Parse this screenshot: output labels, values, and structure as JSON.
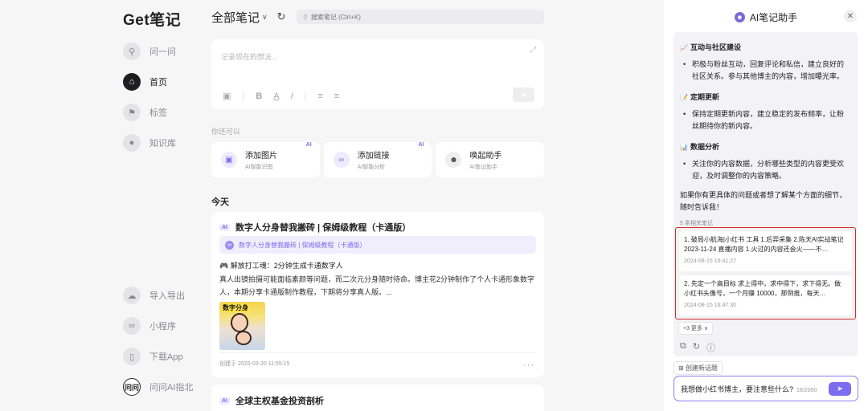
{
  "app": {
    "logo": "Get笔记"
  },
  "sidebar": {
    "top_items": [
      {
        "label": "问一问",
        "icon": "search-icon"
      },
      {
        "label": "首页",
        "icon": "home-icon"
      },
      {
        "label": "标签",
        "icon": "tag-icon"
      },
      {
        "label": "知识库",
        "icon": "knowledge-icon"
      }
    ],
    "bottom_items": [
      {
        "label": "导入导出",
        "icon": "cloud-icon"
      },
      {
        "label": "小程序",
        "icon": "miniapp-icon"
      },
      {
        "label": "下载App",
        "icon": "phone-icon"
      },
      {
        "label": "问问AI指北",
        "icon": "wenwen-icon",
        "icon_text": "问问"
      }
    ]
  },
  "header": {
    "title": "全部笔记",
    "search_placeholder": "搜索笔记 (Ctrl+K)"
  },
  "editor": {
    "placeholder": "记录现在的想法..."
  },
  "suggestions": {
    "hint": "你还可以",
    "items": [
      {
        "title": "添加图片",
        "subtitle": "AI智能识图",
        "badge": "AI"
      },
      {
        "title": "添加链接",
        "subtitle": "AI智能分析",
        "badge": "AI"
      },
      {
        "title": "唤起助手",
        "subtitle": "AI笔记助手",
        "badge": ""
      }
    ]
  },
  "feed": {
    "section": "今天",
    "cards": [
      {
        "tag": "AI",
        "title": "数字人分身替我搬砖 | 保姆级教程（卡通版）",
        "link_text": "数字人分身替我搬砖 | 保姆级教程（卡通版）",
        "subtitle": "🎮 解放打工魂：2分钟生成卡通数字人",
        "body": "真人出镜拍摄可能面临素颜等问题，而二次元分身随时待命。博主花2分钟制作了个人卡通形象数字人，本期分享卡通版制作教程，下期将分享真人版。...",
        "thumb_text": "数字分身",
        "footer": "创建于 2025-03-20 11:55:15",
        "more": "···"
      },
      {
        "tag": "AI",
        "title": "全球主权基金投资剖析"
      }
    ]
  },
  "assistant": {
    "title": "AI笔记助手",
    "close": "✕",
    "sections": [
      {
        "emoji": "📈",
        "heading": "互动与社区建设",
        "bullet": "积极与粉丝互动，回复评论和私信，建立良好的社区关系。参与其他博主的内容，增加曝光率。"
      },
      {
        "emoji": "📝",
        "heading": "定期更新",
        "bullet": "保持定期更新内容，建立稳定的发布频率，让粉丝期待你的新内容。"
      },
      {
        "emoji": "📊",
        "heading": "数据分析",
        "bullet": "关注你的内容数据，分析哪些类型的内容更受欢迎，及时调整你的内容策略。"
      }
    ],
    "closing": "如果你有更具体的问题或者想了解某个方面的细节，随时告诉我！",
    "related_count": "5 条相关笔记",
    "related": [
      {
        "text": "1. 破局小航海|小红书 工具 1.后羿采集 2.陈天AI实战笔记 2023-11-24 直播内容 1.火过的内容还会火——不…",
        "time": "2024-08-15 16:41:27"
      },
      {
        "text": "2. 先定一个高目标 求上得中，求中得下，求下得无。做小红书头像号，一个月赚 10000，那倒推，每天…",
        "time": "2024-08-15 16:47:30"
      }
    ],
    "more_label": "+3 更多 ∨",
    "new_topic": "创建新话题",
    "input_text": "我想做小红书博主，要注意些什么?",
    "input_count": "16/2000"
  }
}
